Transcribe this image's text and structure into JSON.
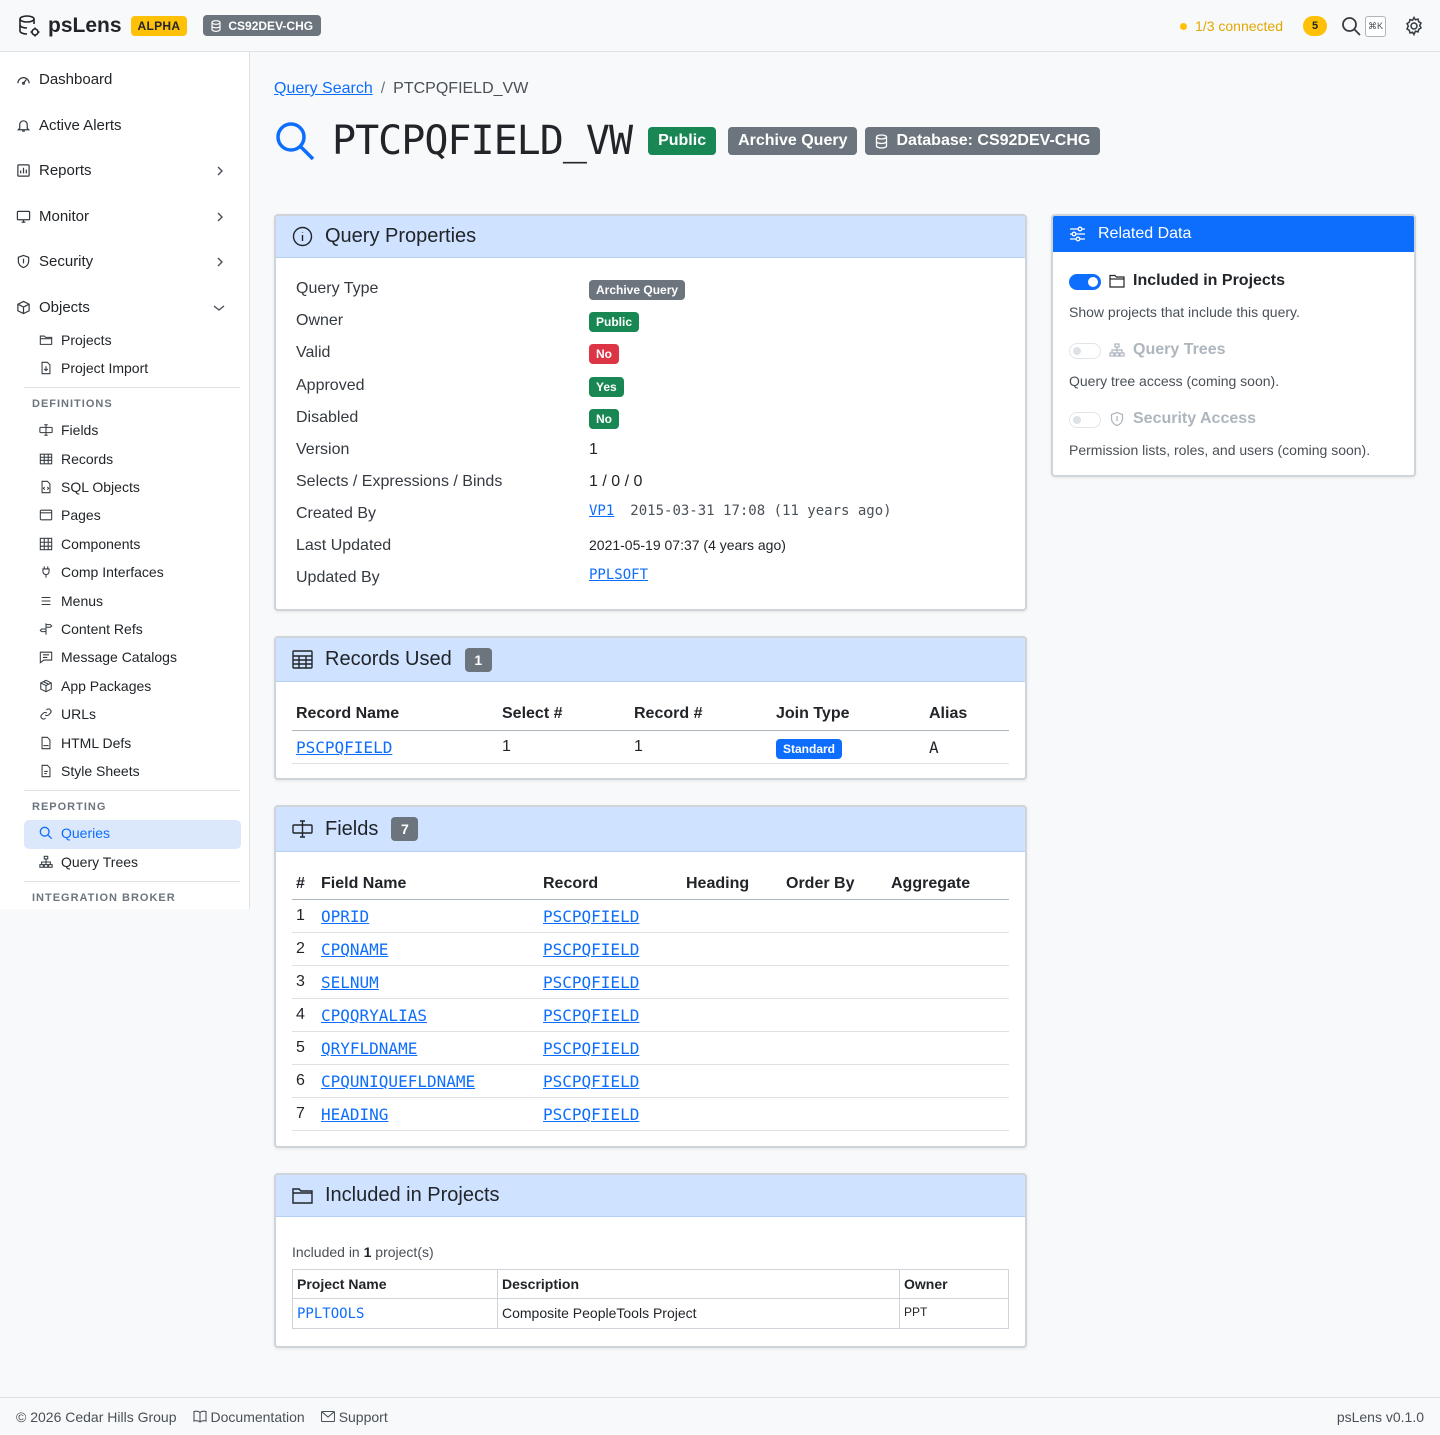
{
  "header": {
    "app_name": "psLens",
    "stage_badge": "ALPHA",
    "db_chip": "CS92DEV-CHG",
    "connection_status": "1/3 connected",
    "alert_count": "5",
    "shortcut_hint": "⌘K",
    "status_color": "#ffc107"
  },
  "sidebar": {
    "main_items": [
      {
        "label": "Dashboard",
        "icon": "speedometer-icon"
      },
      {
        "label": "Active Alerts",
        "icon": "bell-icon"
      },
      {
        "label": "Reports",
        "icon": "bar-chart-icon"
      },
      {
        "label": "Monitor",
        "icon": "monitor-icon"
      },
      {
        "label": "Security",
        "icon": "shield-icon"
      },
      {
        "label": "Objects",
        "icon": "box-icon"
      }
    ],
    "objects_items": [
      {
        "label": "Projects",
        "icon": "folder-icon"
      },
      {
        "label": "Project Import",
        "icon": "file-import-icon"
      }
    ],
    "definitions_heading": "DEFINITIONS",
    "definitions_items": [
      {
        "label": "Fields",
        "icon": "input-cursor-icon"
      },
      {
        "label": "Records",
        "icon": "table-icon"
      },
      {
        "label": "SQL Objects",
        "icon": "file-code-icon"
      },
      {
        "label": "Pages",
        "icon": "window-icon"
      },
      {
        "label": "Components",
        "icon": "grid-icon"
      },
      {
        "label": "Comp Interfaces",
        "icon": "plug-icon"
      },
      {
        "label": "Menus",
        "icon": "list-icon"
      },
      {
        "label": "Content Refs",
        "icon": "signpost-icon"
      },
      {
        "label": "Message Catalogs",
        "icon": "chat-text-icon"
      },
      {
        "label": "App Packages",
        "icon": "package-icon"
      },
      {
        "label": "URLs",
        "icon": "link-icon"
      },
      {
        "label": "HTML Defs",
        "icon": "file-html-icon"
      },
      {
        "label": "Style Sheets",
        "icon": "file-css-icon"
      }
    ],
    "reporting_heading": "REPORTING",
    "reporting_items": [
      {
        "label": "Queries",
        "icon": "search-icon"
      },
      {
        "label": "Query Trees",
        "icon": "diagram-icon"
      }
    ],
    "integration_heading": "INTEGRATION BROKER",
    "active_color": "#0d6efd"
  },
  "breadcrumb": {
    "parent": "Query Search",
    "current": "PTCPQFIELD_VW"
  },
  "page": {
    "title": "PTCPQFIELD_VW",
    "badges": [
      "Public",
      "Archive Query",
      "Database: CS92DEV-CHG"
    ]
  },
  "properties": {
    "title": "Query Properties",
    "rows": [
      {
        "label": "Query Type",
        "value": "Archive Query"
      },
      {
        "label": "Owner",
        "value": "Public"
      },
      {
        "label": "Valid",
        "value": "No"
      },
      {
        "label": "Approved",
        "value": "Yes"
      },
      {
        "label": "Disabled",
        "value": "No"
      },
      {
        "label": "Version",
        "value": "1"
      },
      {
        "label": "Selects / Expressions / Binds",
        "value": "1 / 0 / 0"
      },
      {
        "label": "Created By",
        "value": "VP1",
        "extra": "2015-03-31 17:08 (11 years ago)"
      },
      {
        "label": "Last Updated",
        "value": "2021-05-19 07:37 (4 years ago)"
      },
      {
        "label": "Updated By",
        "value": "PPLSOFT"
      }
    ]
  },
  "records_used": {
    "title": "Records Used",
    "count": "1",
    "columns": [
      "Record Name",
      "Select #",
      "Record #",
      "Join Type",
      "Alias"
    ],
    "rows": [
      {
        "record": "PSCPQFIELD",
        "select": "1",
        "record_num": "1",
        "join": "Standard",
        "alias": "A"
      }
    ]
  },
  "fields": {
    "title": "Fields",
    "count": "7",
    "columns": [
      "#",
      "Field Name",
      "Record",
      "Heading",
      "Order By",
      "Aggregate"
    ],
    "rows": [
      {
        "n": "1",
        "field": "OPRID",
        "record": "PSCPQFIELD"
      },
      {
        "n": "2",
        "field": "CPQNAME",
        "record": "PSCPQFIELD"
      },
      {
        "n": "3",
        "field": "SELNUM",
        "record": "PSCPQFIELD"
      },
      {
        "n": "4",
        "field": "CPQQRYALIAS",
        "record": "PSCPQFIELD"
      },
      {
        "n": "5",
        "field": "QRYFLDNAME",
        "record": "PSCPQFIELD"
      },
      {
        "n": "6",
        "field": "CPQUNIQUEFLDNAME",
        "record": "PSCPQFIELD"
      },
      {
        "n": "7",
        "field": "HEADING",
        "record": "PSCPQFIELD"
      }
    ]
  },
  "projects": {
    "title": "Included in Projects",
    "summary_prefix": "Included in",
    "summary_count": "1",
    "summary_suffix": "project(s)",
    "columns": [
      "Project Name",
      "Description",
      "Owner"
    ],
    "rows": [
      {
        "name": "PPLTOOLS",
        "description": "Composite PeopleTools Project",
        "owner": "PPT"
      }
    ]
  },
  "related": {
    "title": "Related Data",
    "items": [
      {
        "label": "Included in Projects",
        "desc": "Show projects that include this query.",
        "enabled": true
      },
      {
        "label": "Query Trees",
        "desc": "Query tree access (coming soon).",
        "enabled": false
      },
      {
        "label": "Security Access",
        "desc": "Permission lists, roles, and users (coming soon).",
        "enabled": false
      }
    ]
  },
  "footer": {
    "copyright": "© 2026 Cedar Hills Group",
    "docs": "Documentation",
    "support": "Support",
    "version": "psLens v0.1.0"
  }
}
